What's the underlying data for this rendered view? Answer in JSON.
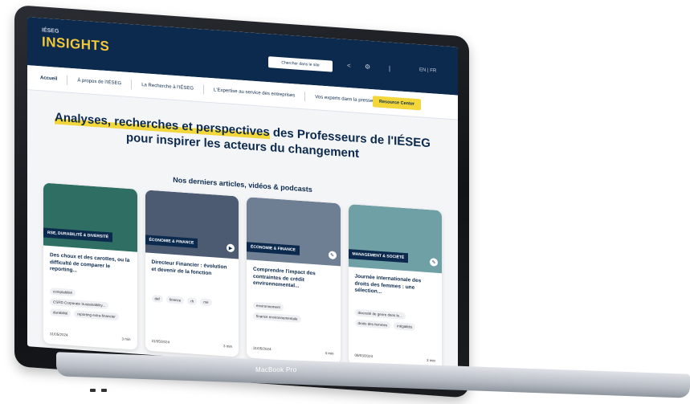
{
  "header": {
    "logo_small": "IÉSEG",
    "logo_main": "INSIGHTS",
    "search_label": "Chercher dans le site",
    "lang": "EN | FR"
  },
  "nav": {
    "items": [
      {
        "label": "Accueil",
        "active": true
      },
      {
        "label": "À propos de l'IÉSEG",
        "active": false
      },
      {
        "label": "La Recherche à l'IÉSEG",
        "active": false
      },
      {
        "label": "L'Expertise au service des entreprises",
        "active": false
      },
      {
        "label": "Vos experts dans la presse",
        "active": false
      }
    ],
    "resource_button": "Resource Center"
  },
  "hero": {
    "highlight": "Analyses, recherches et perspectives",
    "title_rest": " des Professeurs de l'IÉSEG pour inspirer les acteurs du changement"
  },
  "section": {
    "title": "Nos derniers articles, vidéos & podcasts"
  },
  "cards": [
    {
      "tag": "RSE, DURABILITÉ & DIVERSITÉ",
      "title": "Des choux et des carottes, ou la difficulté de comparer le reporting...",
      "chips": [
        "comptabilité",
        "CSRD Corporate Sustainability...",
        "durabilité",
        "reporting extra-financier"
      ],
      "date": "31/05/2024",
      "read": "3 min",
      "thumb_color": "#2f6e62"
    },
    {
      "tag": "ÉCONOMIE & FINANCE",
      "title": "Directeur Financier : évolution et devenir de la fonction",
      "chips": [
        "daf",
        "finance",
        "rh",
        "rse"
      ],
      "date": "31/05/2024",
      "read": "3 min",
      "thumb_color": "#4c5b72"
    },
    {
      "tag": "ÉCONOMIE & FINANCE",
      "title": "Comprendre l'impact des contraintes de crédit environnemental...",
      "chips": [
        "environnement",
        "finance environnementale"
      ],
      "date": "31/05/2024",
      "read": "4 min",
      "thumb_color": "#6e7e93"
    },
    {
      "tag": "MANAGEMENT & SOCIÉTÉ",
      "title": "Journée internationale des droits des femmes : une sélection...",
      "chips": [
        "diversité de genre dans le...",
        "droits des femmes",
        "inégalités"
      ],
      "date": "08/03/2024",
      "read": "3 min",
      "thumb_color": "#6fa0a6"
    }
  ],
  "laptop": {
    "model_label": "MacBook Pro"
  }
}
